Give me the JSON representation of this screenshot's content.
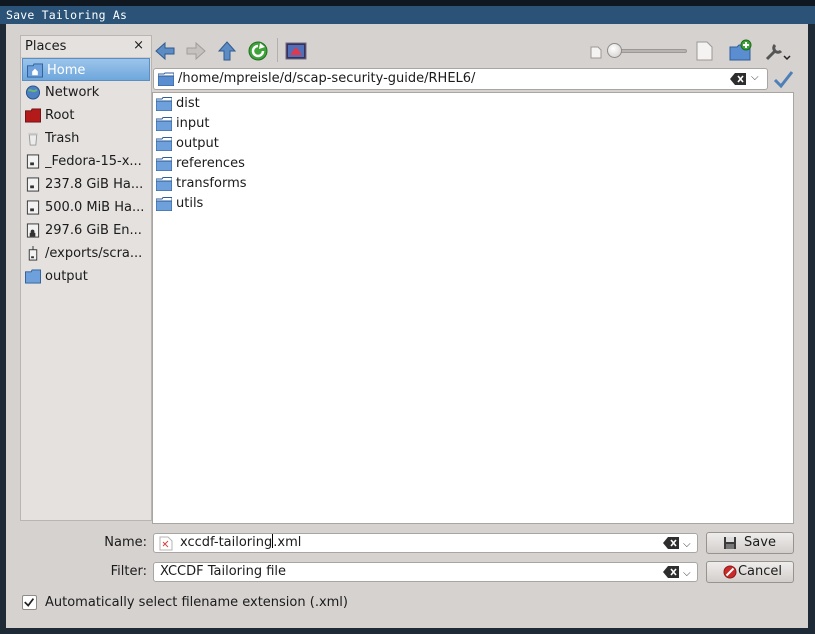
{
  "window": {
    "title": "Save Tailoring As"
  },
  "places": {
    "header": "Places",
    "close": "×",
    "items": [
      {
        "label": "Home",
        "icon": "home-folder-icon",
        "selected": true
      },
      {
        "label": "Network",
        "icon": "network-globe-icon"
      },
      {
        "label": "Root",
        "icon": "root-folder-icon"
      },
      {
        "label": "Trash",
        "icon": "trash-icon"
      },
      {
        "label": "_Fedora-15-x...",
        "icon": "drive-icon"
      },
      {
        "label": "237.8 GiB Ha...",
        "icon": "drive-icon"
      },
      {
        "label": "500.0 MiB Ha...",
        "icon": "drive-icon"
      },
      {
        "label": "297.6 GiB En...",
        "icon": "encrypted-drive-icon"
      },
      {
        "label": "/exports/scra...",
        "icon": "network-drive-icon"
      },
      {
        "label": "output",
        "icon": "folder-icon"
      }
    ]
  },
  "location": {
    "path": "/home/mpreisle/d/scap-security-guide/RHEL6/"
  },
  "files": [
    "dist",
    "input",
    "output",
    "references",
    "transforms",
    "utils"
  ],
  "form": {
    "name_label": "Name:",
    "name_value_pre": "xccdf-tailoring",
    "name_value_post": ".xml",
    "filter_label": "Filter:",
    "filter_value": "XCCDF Tailoring file",
    "save_label": "Save",
    "cancel_label": "Cancel",
    "auto_ext_label": "Automatically select filename extension (.xml)",
    "auto_ext_checked": true
  }
}
